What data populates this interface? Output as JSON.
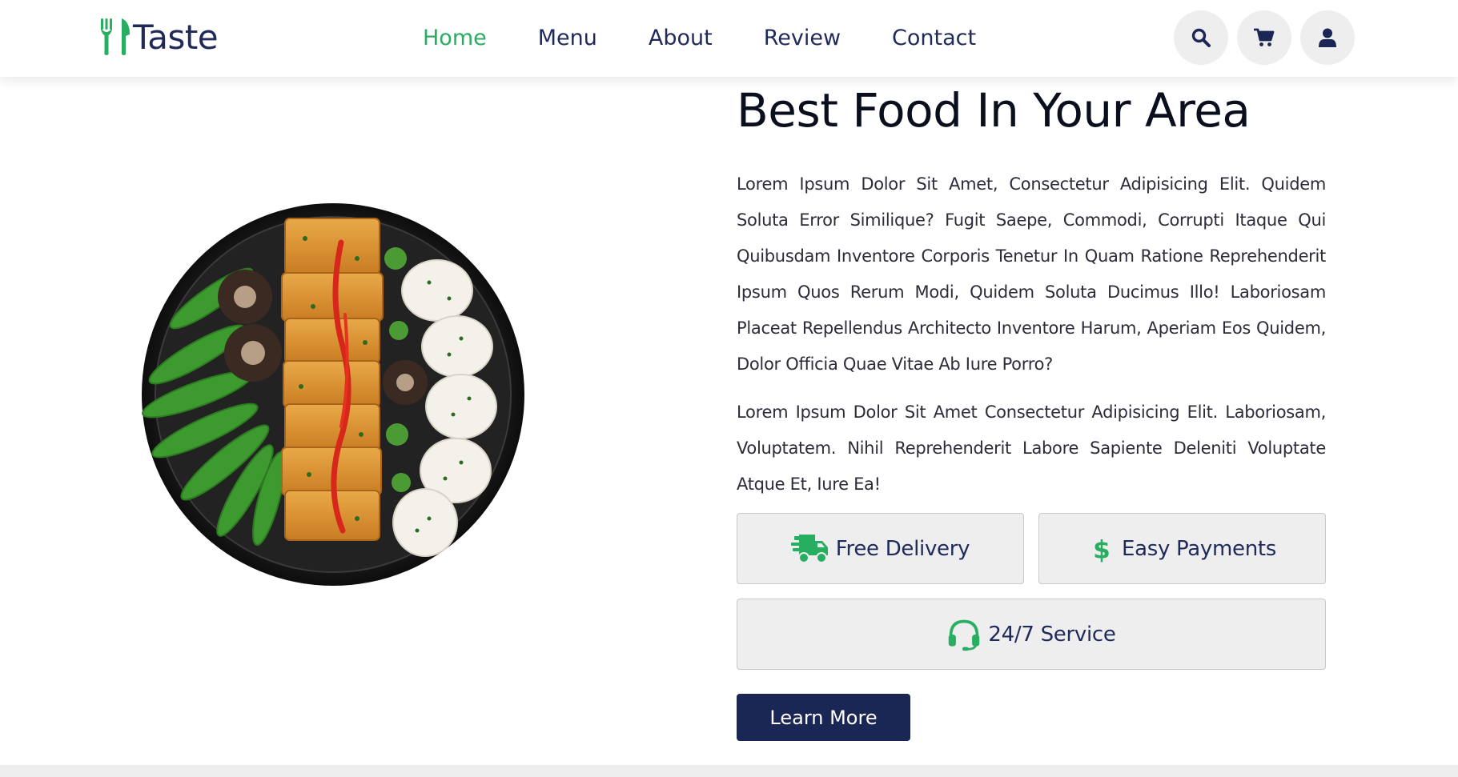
{
  "brand": {
    "name": "Taste",
    "accent_color": "#27ae60",
    "primary_color": "#1a2654"
  },
  "nav": {
    "items": [
      {
        "label": "Home",
        "active": true
      },
      {
        "label": "Menu",
        "active": false
      },
      {
        "label": "About",
        "active": false
      },
      {
        "label": "Review",
        "active": false
      },
      {
        "label": "Contact",
        "active": false
      }
    ]
  },
  "header_icons": [
    "search-icon",
    "cart-icon",
    "user-icon"
  ],
  "hero": {
    "image_icon": "food-plate-image",
    "title": "Best Food In Your Area",
    "paragraph_1": "Lorem Ipsum Dolor Sit Amet, Consectetur Adipisicing Elit. Quidem Soluta Error Similique? Fugit Saepe, Commodi, Corrupti Itaque Qui Quibusdam Inventore Corporis Tenetur In Quam Ratione Reprehenderit Ipsum Quos Rerum Modi, Quidem Soluta Ducimus Illo! Laboriosam Placeat Repellendus Architecto Inventore Harum, Aperiam Eos Quidem, Dolor Officia Quae Vitae Ab Iure Porro?",
    "paragraph_2": "Lorem Ipsum Dolor Sit Amet Consectetur Adipisicing Elit. Laboriosam, Voluptatem. Nihil Reprehenderit Labore Sapiente Deleniti Voluptate Atque Et, Iure Ea!",
    "features": [
      {
        "label": "Free Delivery",
        "icon": "truck-icon"
      },
      {
        "label": "Easy Payments",
        "icon": "dollar-icon"
      },
      {
        "label": "24/7 Service",
        "icon": "headset-icon"
      }
    ],
    "cta_label": "Learn More"
  }
}
